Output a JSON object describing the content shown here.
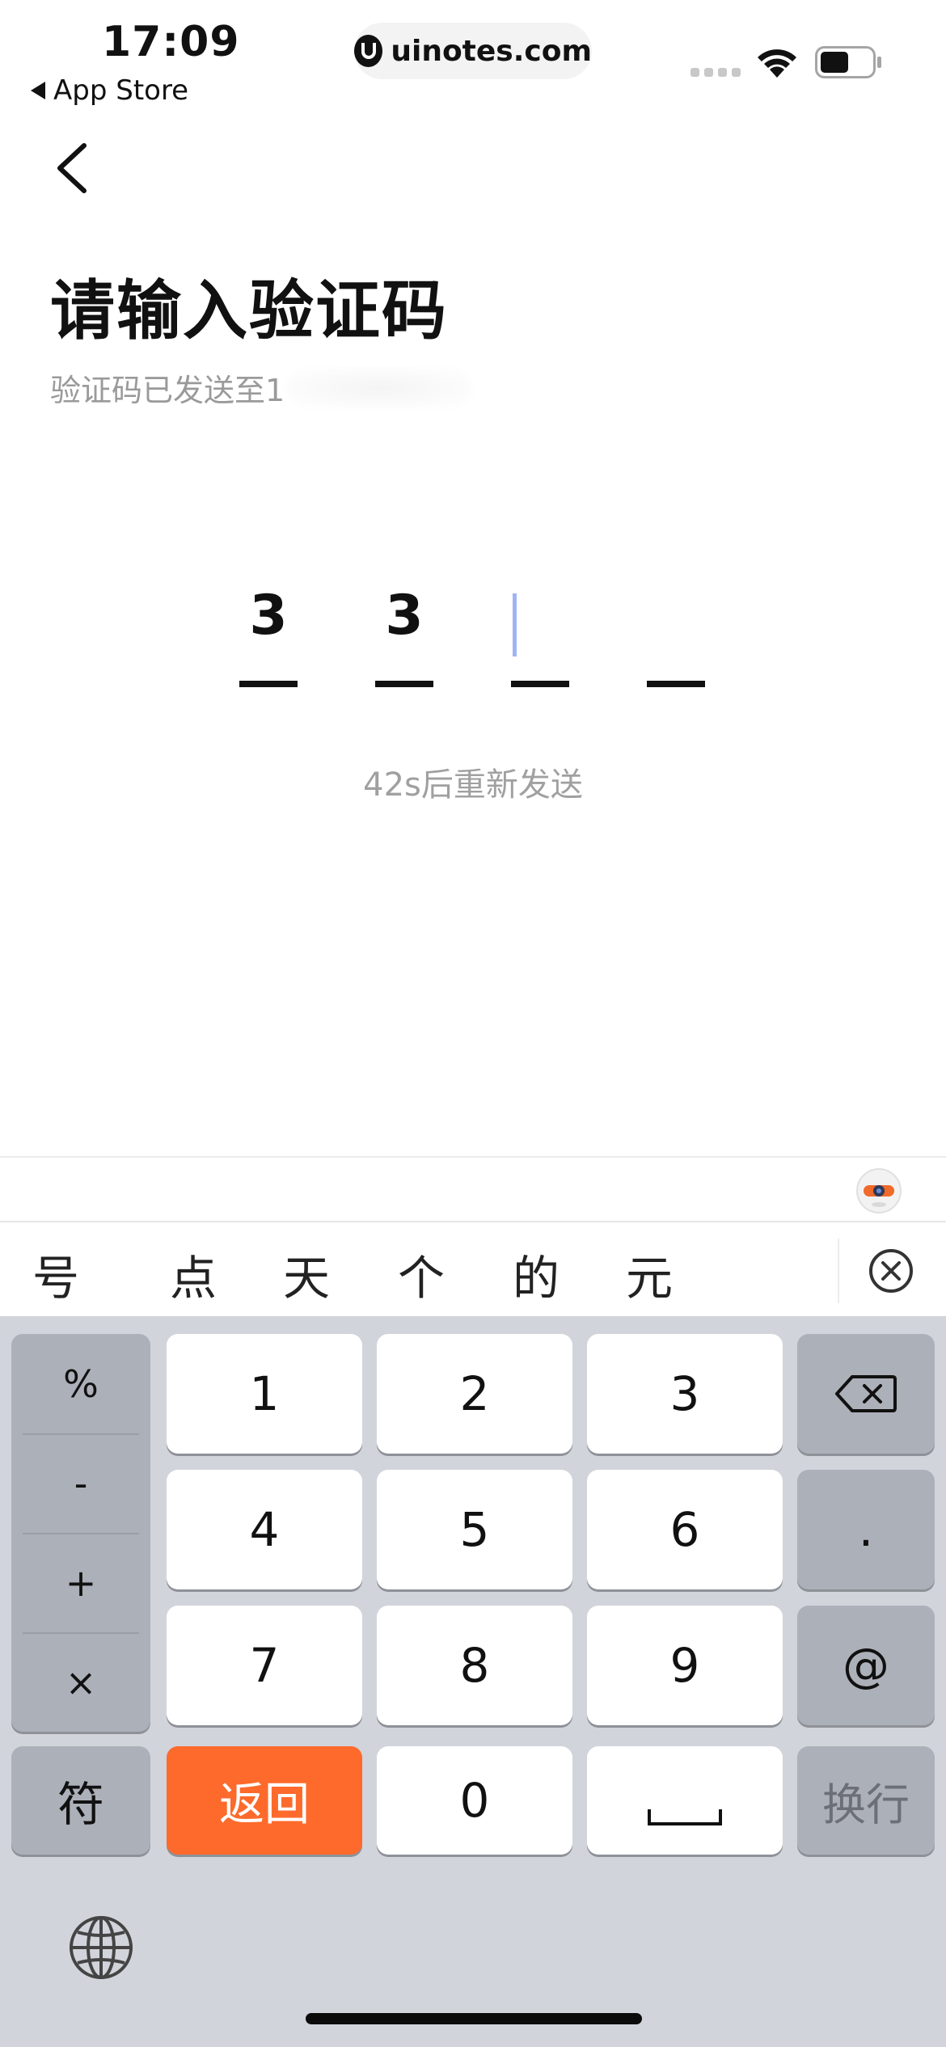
{
  "status_bar": {
    "time": "17:09",
    "back_app": "App Store",
    "url": "uinotes.com"
  },
  "page": {
    "title": "请输入验证码",
    "subtitle_prefix": "验证码已发送至1",
    "code_digits": [
      "3",
      "3",
      "",
      ""
    ],
    "resend": "42s后重新发送"
  },
  "keyboard": {
    "candidates": [
      "号",
      "点",
      "天",
      "个",
      "的",
      "元"
    ],
    "symbols": [
      "%",
      "-",
      "+",
      "×"
    ],
    "digits": [
      "1",
      "2",
      "3",
      "4",
      "5",
      "6",
      "7",
      "8",
      "9",
      "0"
    ],
    "dot": ".",
    "at": "@",
    "symbol_key": "符",
    "return_key": "返回",
    "newline_key": "换行",
    "accent_color": "#fd6a2b"
  }
}
